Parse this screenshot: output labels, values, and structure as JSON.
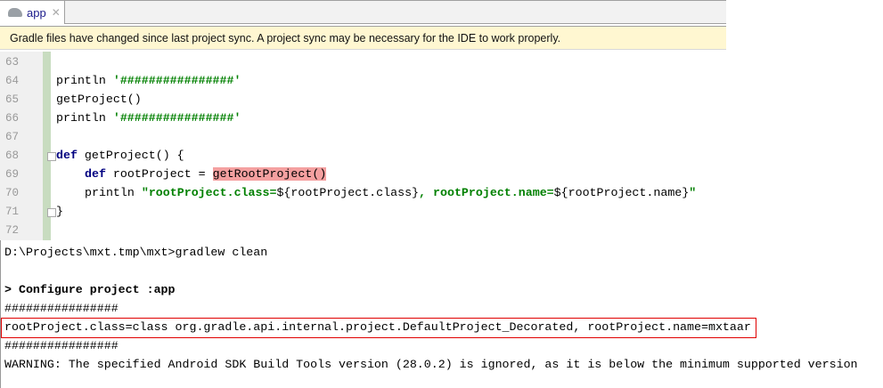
{
  "tab": {
    "label": "app",
    "icon": "gradle-elephant-icon",
    "close": "✕"
  },
  "banner": {
    "text": "Gradle files have changed since last project sync. A project sync may be necessary for the IDE to work properly."
  },
  "editor": {
    "line_numbers": [
      "63",
      "64",
      "65",
      "66",
      "67",
      "68",
      "69",
      "70",
      "71",
      "72"
    ],
    "lines": {
      "l64a": "println ",
      "l64b": "'################'",
      "l65": "getProject()",
      "l66a": "println ",
      "l66b": "'################'",
      "l68a": "def",
      "l68b": " getProject() {",
      "l69a": "def",
      "l69b": " rootProject = ",
      "l69c": "getRootProject()",
      "l70a": "println ",
      "l70b": "\"rootProject.class=",
      "l70c": "${rootProject.class}",
      "l70d": ", rootProject.name=",
      "l70e": "${rootProject.name}",
      "l70f": "\"",
      "l71": "}"
    }
  },
  "console": {
    "lines": [
      "D:\\Projects\\mxt.tmp\\mxt>gradlew clean",
      "> Configure project :app",
      "################",
      "rootProject.class=class org.gradle.api.internal.project.DefaultProject_Decorated, rootProject.name=mxtaar",
      "################",
      "WARNING: The specified Android SDK Build Tools version (28.0.2) is ignored, as it is below the minimum supported version"
    ]
  }
}
